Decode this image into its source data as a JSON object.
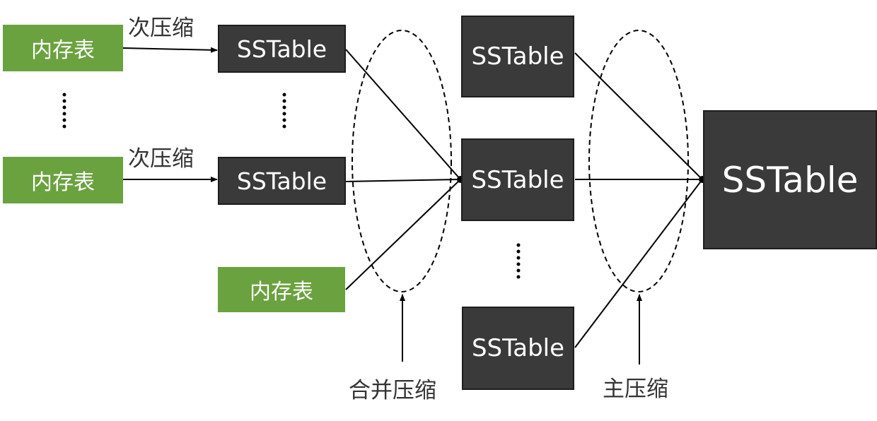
{
  "memtables": {
    "mt1": "内存表",
    "mt2": "内存表",
    "mt3": "内存表"
  },
  "sstables": {
    "l0_1": "SSTable",
    "l0_2": "SSTable",
    "l1_top": "SSTable",
    "l1_mid": "SSTable",
    "l1_bottom": "SSTable",
    "major": "SSTable"
  },
  "labels": {
    "minor_1": "次压缩",
    "minor_2": "次压缩",
    "merge": "合并压缩",
    "major": "主压缩"
  },
  "colors": {
    "memtable": "#6aa23f",
    "sstable": "#3a3a3a",
    "text_on_box": "#ffffff",
    "line": "#000000"
  }
}
